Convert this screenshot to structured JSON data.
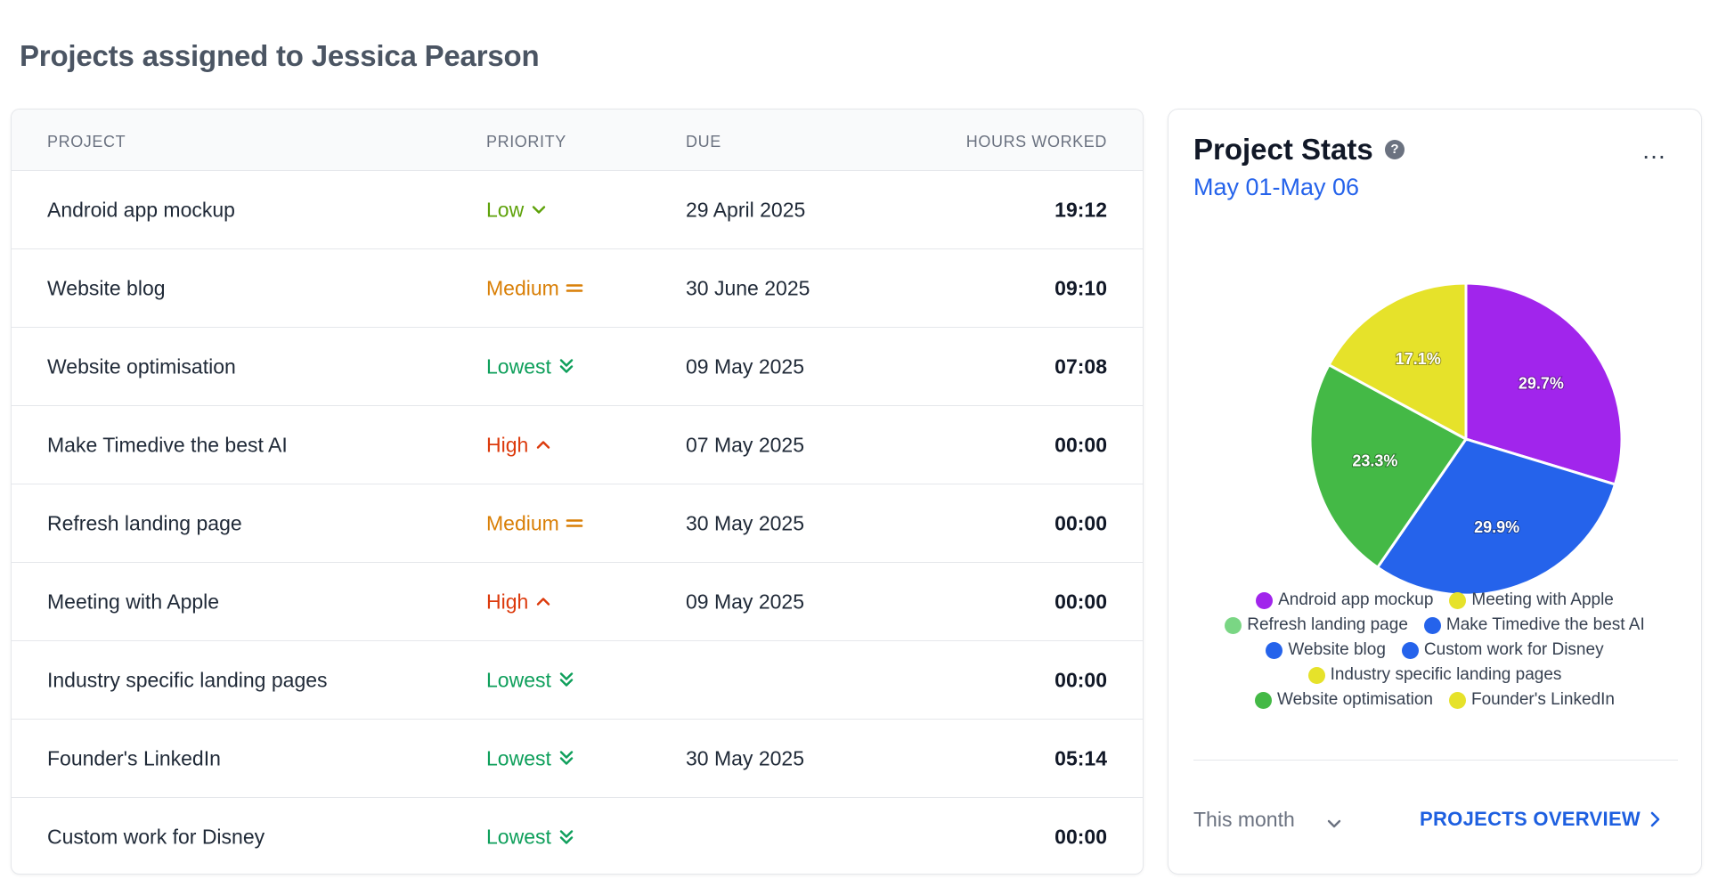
{
  "header": {
    "title": "Projects assigned to Jessica Pearson"
  },
  "table": {
    "columns": {
      "project": "PROJECT",
      "priority": "PRIORITY",
      "due": "DUE",
      "hours": "HOURS WORKED"
    },
    "rows": [
      {
        "project": "Android app mockup",
        "priority": "Low",
        "priority_icon": "chevron-down-icon",
        "due": "29 April 2025",
        "hours": "19:12"
      },
      {
        "project": "Website blog",
        "priority": "Medium",
        "priority_icon": "equals-icon",
        "due": "30 June 2025",
        "hours": "09:10"
      },
      {
        "project": "Website optimisation",
        "priority": "Lowest",
        "priority_icon": "double-chevron-down-icon",
        "due": "09 May 2025",
        "hours": "07:08"
      },
      {
        "project": "Make Timedive the best AI",
        "priority": "High",
        "priority_icon": "chevron-up-icon",
        "due": "07 May 2025",
        "hours": "00:00"
      },
      {
        "project": "Refresh landing page",
        "priority": "Medium",
        "priority_icon": "equals-icon",
        "due": "30 May 2025",
        "hours": "00:00"
      },
      {
        "project": "Meeting with Apple",
        "priority": "High",
        "priority_icon": "chevron-up-icon",
        "due": "09 May 2025",
        "hours": "00:00"
      },
      {
        "project": "Industry specific landing pages",
        "priority": "Lowest",
        "priority_icon": "double-chevron-down-icon",
        "due": "",
        "hours": "00:00"
      },
      {
        "project": "Founder's LinkedIn",
        "priority": "Lowest",
        "priority_icon": "double-chevron-down-icon",
        "due": "30 May 2025",
        "hours": "05:14"
      },
      {
        "project": "Custom work for Disney",
        "priority": "Lowest",
        "priority_icon": "double-chevron-down-icon",
        "due": "",
        "hours": "00:00"
      }
    ]
  },
  "priority_colors": {
    "Low": "#5ea20a",
    "Medium": "#d97f06",
    "Lowest": "#0e9f5b",
    "High": "#dc3a0c"
  },
  "stats": {
    "title": "Project Stats",
    "help_icon": "question-circle-icon",
    "more_icon": "ellipsis-icon",
    "date_range": "May 01-May 06",
    "range_select": "This month",
    "overview_link": "PROJECTS OVERVIEW"
  },
  "chart_data": {
    "type": "pie",
    "slices": [
      {
        "label": "29.7%",
        "value": 29.7,
        "color": "#a125ec"
      },
      {
        "label": "29.9%",
        "value": 29.9,
        "color": "#2563eb"
      },
      {
        "label": "23.3%",
        "value": 23.3,
        "color": "#44b946"
      },
      {
        "label": "17.1%",
        "value": 17.1,
        "color": "#e6e22a"
      }
    ],
    "legend": [
      {
        "name": "Android app mockup",
        "color": "#a125ec"
      },
      {
        "name": "Meeting with Apple",
        "color": "#e6e22a"
      },
      {
        "name": "Refresh landing page",
        "color": "#7ad684"
      },
      {
        "name": "Make Timedive the best AI",
        "color": "#2563eb"
      },
      {
        "name": "Website blog",
        "color": "#2563eb"
      },
      {
        "name": "Custom work for Disney",
        "color": "#2563eb"
      },
      {
        "name": "Industry specific landing pages",
        "color": "#e6e22a"
      },
      {
        "name": "Website optimisation",
        "color": "#44b946"
      },
      {
        "name": "Founder's LinkedIn",
        "color": "#e6e22a"
      }
    ]
  }
}
